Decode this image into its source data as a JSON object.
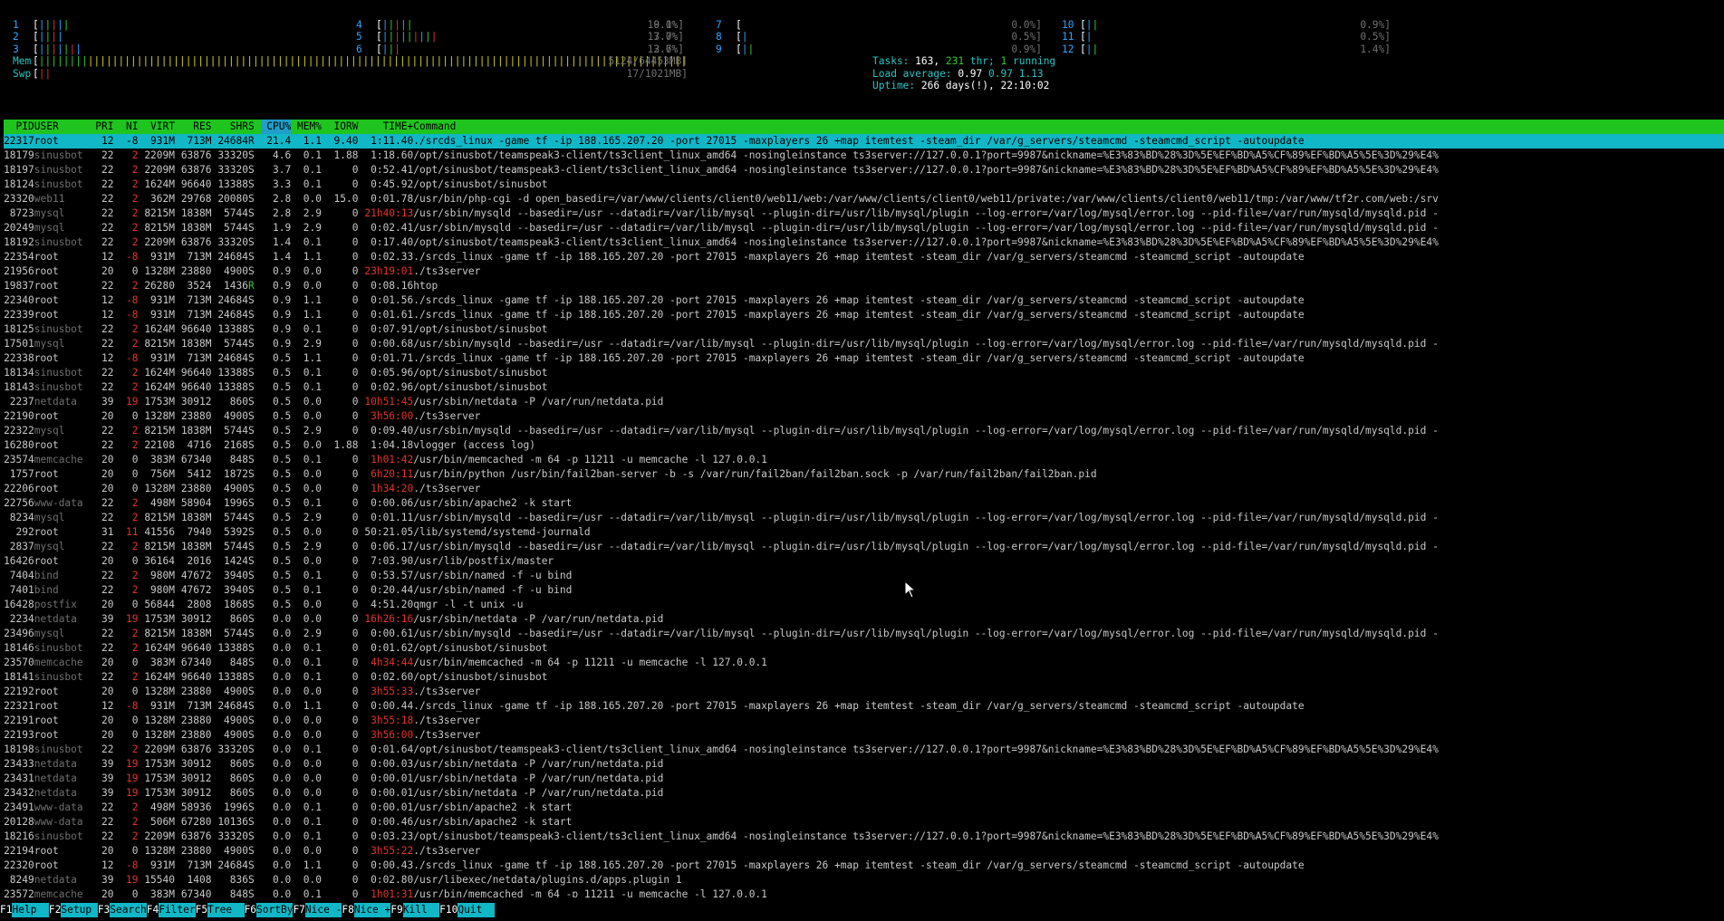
{
  "cpus": [
    {
      "id": "1",
      "bar": "|||||",
      "pct": "10.1%]"
    },
    {
      "id": "2",
      "bar": "||||",
      "pct": "7.0%]"
    },
    {
      "id": "3",
      "bar": "|||||||",
      "pct": "12.6%]"
    },
    {
      "id": "4",
      "bar": "|||||",
      "pct": "9.0%]"
    },
    {
      "id": "5",
      "bar": "|||||||||",
      "pct": "13.7%]"
    },
    {
      "id": "6",
      "bar": "|||",
      "pct": "3.7%]"
    },
    {
      "id": "7",
      "bar": "",
      "pct": "0.0%]"
    },
    {
      "id": "8",
      "bar": "|",
      "pct": "0.5%]"
    },
    {
      "id": "9",
      "bar": "||",
      "pct": "0.9%]"
    },
    {
      "id": "10",
      "bar": "||",
      "pct": "0.9%]"
    },
    {
      "id": "11",
      "bar": "|",
      "pct": "0.5%]"
    },
    {
      "id": "12",
      "bar": "||",
      "pct": "1.4%]"
    }
  ],
  "mem": {
    "label": "Mem",
    "bar": "||||||||||||||||||||||||||||||||||||||||||||||||||||||||||||||||||||||||||||||||||||||||||||||||||||||||||||||||||||||||||||||||||||||||||||||||||||",
    "value": "5124/64453MB]"
  },
  "swp": {
    "label": "Swp",
    "bar": "||",
    "value": "17/1021MB]"
  },
  "tasks": {
    "label": "Tasks:",
    "value": "163,",
    "thr": "231",
    "thr_label": "thr;",
    "running": "1",
    "running_label": "running"
  },
  "load": {
    "label": "Load average:",
    "v1": "0.97",
    "v2": "0.97",
    "v3": "1.13"
  },
  "uptime": {
    "label": "Uptime:",
    "value": "266 days(!), 22:10:02"
  },
  "columns": [
    "  PID",
    "USER     ",
    "PRI",
    " NI",
    " VIRT",
    "  RES",
    "  SHR",
    "S",
    "CPU%",
    "MEM%",
    "IORW ",
    "  TIME+ ",
    "Command"
  ],
  "processes": [
    [
      "22317",
      "root",
      "12",
      "-8",
      "931M",
      "713M",
      "24684",
      "R",
      "21.4",
      "1.1",
      "9.40",
      "1:11.40",
      "./srcds_linux -game tf -ip 188.165.207.20 -port 27015 -maxplayers 26 +map itemtest -steam_dir /var/g_servers/steamcmd -steamcmd_script -autoupdate"
    ],
    [
      "18179",
      "sinusbot",
      "22",
      "2",
      "2209M",
      "63876",
      "33320",
      "S",
      "4.6",
      "0.1",
      "1.88",
      "1:18.60",
      "/opt/sinusbot/teamspeak3-client/ts3client_linux_amd64 -nosingleinstance ts3server://127.0.0.1?port=9987&nickname=%E3%83%BD%28%3D%5E%EF%BD%A5%CF%89%EF%BD%A5%5E%3D%29%E4%"
    ],
    [
      "18197",
      "sinusbot",
      "22",
      "2",
      "2209M",
      "63876",
      "33320",
      "S",
      "3.7",
      "0.1",
      "0",
      "0:52.41",
      "/opt/sinusbot/teamspeak3-client/ts3client_linux_amd64 -nosingleinstance ts3server://127.0.0.1?port=9987&nickname=%E3%83%BD%28%3D%5E%EF%BD%A5%CF%89%EF%BD%A5%5E%3D%29%E4%"
    ],
    [
      "18124",
      "sinusbot",
      "22",
      "2",
      "1624M",
      "96640",
      "13388",
      "S",
      "3.3",
      "0.1",
      "0",
      "0:45.92",
      "/opt/sinusbot/sinusbot"
    ],
    [
      "23320",
      "web11",
      "22",
      "2",
      "362M",
      "29768",
      "20080",
      "S",
      "2.8",
      "0.0",
      "15.0",
      "0:01.78",
      "/usr/bin/php-cgi -d open_basedir=/var/www/clients/client0/web11/web:/var/www/clients/client0/web11/private:/var/www/clients/client0/web11/tmp:/var/www/tf2r.com/web:/srv"
    ],
    [
      "8723",
      "mysql",
      "22",
      "2",
      "8215M",
      "1838M",
      "5744",
      "S",
      "2.8",
      "2.9",
      "0",
      "21h40:13",
      "/usr/sbin/mysqld --basedir=/usr --datadir=/var/lib/mysql --plugin-dir=/usr/lib/mysql/plugin --log-error=/var/log/mysql/error.log --pid-file=/var/run/mysqld/mysqld.pid -"
    ],
    [
      "20249",
      "mysql",
      "22",
      "2",
      "8215M",
      "1838M",
      "5744",
      "S",
      "1.9",
      "2.9",
      "0",
      "0:02.41",
      "/usr/sbin/mysqld --basedir=/usr --datadir=/var/lib/mysql --plugin-dir=/usr/lib/mysql/plugin --log-error=/var/log/mysql/error.log --pid-file=/var/run/mysqld/mysqld.pid -"
    ],
    [
      "18192",
      "sinusbot",
      "22",
      "2",
      "2209M",
      "63876",
      "33320",
      "S",
      "1.4",
      "0.1",
      "0",
      "0:17.40",
      "/opt/sinusbot/teamspeak3-client/ts3client_linux_amd64 -nosingleinstance ts3server://127.0.0.1?port=9987&nickname=%E3%83%BD%28%3D%5E%EF%BD%A5%CF%89%EF%BD%A5%5E%3D%29%E4%"
    ],
    [
      "22354",
      "root",
      "12",
      "-8",
      "931M",
      "713M",
      "24684",
      "S",
      "1.4",
      "1.1",
      "0",
      "0:02.33",
      "./srcds_linux -game tf -ip 188.165.207.20 -port 27015 -maxplayers 26 +map itemtest -steam_dir /var/g_servers/steamcmd -steamcmd_script -autoupdate"
    ],
    [
      "21956",
      "root",
      "20",
      "0",
      "1328M",
      "23880",
      "4900",
      "S",
      "0.9",
      "0.0",
      "0",
      "23h19:01",
      "./ts3server"
    ],
    [
      "19837",
      "root",
      "22",
      "2",
      "26280",
      "3524",
      "1436",
      "R",
      "0.9",
      "0.0",
      "0",
      "0:08.16",
      "htop"
    ],
    [
      "22340",
      "root",
      "12",
      "-8",
      "931M",
      "713M",
      "24684",
      "S",
      "0.9",
      "1.1",
      "0",
      "0:01.56",
      "./srcds_linux -game tf -ip 188.165.207.20 -port 27015 -maxplayers 26 +map itemtest -steam_dir /var/g_servers/steamcmd -steamcmd_script -autoupdate"
    ],
    [
      "22339",
      "root",
      "12",
      "-8",
      "931M",
      "713M",
      "24684",
      "S",
      "0.9",
      "1.1",
      "0",
      "0:01.61",
      "./srcds_linux -game tf -ip 188.165.207.20 -port 27015 -maxplayers 26 +map itemtest -steam_dir /var/g_servers/steamcmd -steamcmd_script -autoupdate"
    ],
    [
      "18125",
      "sinusbot",
      "22",
      "2",
      "1624M",
      "96640",
      "13388",
      "S",
      "0.9",
      "0.1",
      "0",
      "0:07.91",
      "/opt/sinusbot/sinusbot"
    ],
    [
      "17501",
      "mysql",
      "22",
      "2",
      "8215M",
      "1838M",
      "5744",
      "S",
      "0.9",
      "2.9",
      "0",
      "0:00.68",
      "/usr/sbin/mysqld --basedir=/usr --datadir=/var/lib/mysql --plugin-dir=/usr/lib/mysql/plugin --log-error=/var/log/mysql/error.log --pid-file=/var/run/mysqld/mysqld.pid -"
    ],
    [
      "22338",
      "root",
      "12",
      "-8",
      "931M",
      "713M",
      "24684",
      "S",
      "0.5",
      "1.1",
      "0",
      "0:01.71",
      "./srcds_linux -game tf -ip 188.165.207.20 -port 27015 -maxplayers 26 +map itemtest -steam_dir /var/g_servers/steamcmd -steamcmd_script -autoupdate"
    ],
    [
      "18134",
      "sinusbot",
      "22",
      "2",
      "1624M",
      "96640",
      "13388",
      "S",
      "0.5",
      "0.1",
      "0",
      "0:05.96",
      "/opt/sinusbot/sinusbot"
    ],
    [
      "18143",
      "sinusbot",
      "22",
      "2",
      "1624M",
      "96640",
      "13388",
      "S",
      "0.5",
      "0.1",
      "0",
      "0:02.96",
      "/opt/sinusbot/sinusbot"
    ],
    [
      "2237",
      "netdata",
      "39",
      "19",
      "1753M",
      "30912",
      "860",
      "S",
      "0.5",
      "0.0",
      "0",
      "10h51:45",
      "/usr/sbin/netdata -P /var/run/netdata.pid"
    ],
    [
      "22190",
      "root",
      "20",
      "0",
      "1328M",
      "23880",
      "4900",
      "S",
      "0.5",
      "0.0",
      "0",
      "3h56:00",
      "./ts3server"
    ],
    [
      "22322",
      "mysql",
      "22",
      "2",
      "8215M",
      "1838M",
      "5744",
      "S",
      "0.5",
      "2.9",
      "0",
      "0:09.40",
      "/usr/sbin/mysqld --basedir=/usr --datadir=/var/lib/mysql --plugin-dir=/usr/lib/mysql/plugin --log-error=/var/log/mysql/error.log --pid-file=/var/run/mysqld/mysqld.pid -"
    ],
    [
      "16280",
      "root",
      "22",
      "2",
      "22108",
      "4716",
      "2168",
      "S",
      "0.5",
      "0.0",
      "1.88",
      "1:04.18",
      "vlogger (access log)"
    ],
    [
      "23574",
      "memcache",
      "20",
      "0",
      "383M",
      "67340",
      "848",
      "S",
      "0.5",
      "0.1",
      "0",
      "1h01:42",
      "/usr/bin/memcached -m 64 -p 11211 -u memcache -l 127.0.0.1"
    ],
    [
      "1757",
      "root",
      "20",
      "0",
      "756M",
      "5412",
      "1872",
      "S",
      "0.5",
      "0.0",
      "0",
      "6h20:11",
      "/usr/bin/python /usr/bin/fail2ban-server -b -s /var/run/fail2ban/fail2ban.sock -p /var/run/fail2ban/fail2ban.pid"
    ],
    [
      "22206",
      "root",
      "20",
      "0",
      "1328M",
      "23880",
      "4900",
      "S",
      "0.5",
      "0.0",
      "0",
      "1h34:20",
      "./ts3server"
    ],
    [
      "22756",
      "www-data",
      "22",
      "2",
      "498M",
      "58904",
      "1996",
      "S",
      "0.5",
      "0.1",
      "0",
      "0:00.06",
      "/usr/sbin/apache2 -k start"
    ],
    [
      "8234",
      "mysql",
      "22",
      "2",
      "8215M",
      "1838M",
      "5744",
      "S",
      "0.5",
      "2.9",
      "0",
      "0:01.11",
      "/usr/sbin/mysqld --basedir=/usr --datadir=/var/lib/mysql --plugin-dir=/usr/lib/mysql/plugin --log-error=/var/log/mysql/error.log --pid-file=/var/run/mysqld/mysqld.pid -"
    ],
    [
      "292",
      "root",
      "31",
      "11",
      "41556",
      "7940",
      "5392",
      "S",
      "0.5",
      "0.0",
      "0",
      "50:21.05",
      "/lib/systemd/systemd-journald"
    ],
    [
      "2837",
      "mysql",
      "22",
      "2",
      "8215M",
      "1838M",
      "5744",
      "S",
      "0.5",
      "2.9",
      "0",
      "0:06.17",
      "/usr/sbin/mysqld --basedir=/usr --datadir=/var/lib/mysql --plugin-dir=/usr/lib/mysql/plugin --log-error=/var/log/mysql/error.log --pid-file=/var/run/mysqld/mysqld.pid -"
    ],
    [
      "16426",
      "root",
      "20",
      "0",
      "36164",
      "2016",
      "1424",
      "S",
      "0.5",
      "0.0",
      "0",
      "7:03.90",
      "/usr/lib/postfix/master"
    ],
    [
      "7404",
      "bind",
      "22",
      "2",
      "980M",
      "47672",
      "3940",
      "S",
      "0.5",
      "0.1",
      "0",
      "0:53.57",
      "/usr/sbin/named -f -u bind"
    ],
    [
      "7401",
      "bind",
      "22",
      "2",
      "980M",
      "47672",
      "3940",
      "S",
      "0.5",
      "0.1",
      "0",
      "0:20.44",
      "/usr/sbin/named -f -u bind"
    ],
    [
      "16428",
      "postfix",
      "20",
      "0",
      "56844",
      "2808",
      "1868",
      "S",
      "0.5",
      "0.0",
      "0",
      "4:51.20",
      "qmgr -l -t unix -u"
    ],
    [
      "2234",
      "netdata",
      "39",
      "19",
      "1753M",
      "30912",
      "860",
      "S",
      "0.0",
      "0.0",
      "0",
      "16h26:16",
      "/usr/sbin/netdata -P /var/run/netdata.pid"
    ],
    [
      "23496",
      "mysql",
      "22",
      "2",
      "8215M",
      "1838M",
      "5744",
      "S",
      "0.0",
      "2.9",
      "0",
      "0:00.61",
      "/usr/sbin/mysqld --basedir=/usr --datadir=/var/lib/mysql --plugin-dir=/usr/lib/mysql/plugin --log-error=/var/log/mysql/error.log --pid-file=/var/run/mysqld/mysqld.pid -"
    ],
    [
      "18146",
      "sinusbot",
      "22",
      "2",
      "1624M",
      "96640",
      "13388",
      "S",
      "0.0",
      "0.1",
      "0",
      "0:01.62",
      "/opt/sinusbot/sinusbot"
    ],
    [
      "23570",
      "memcache",
      "20",
      "0",
      "383M",
      "67340",
      "848",
      "S",
      "0.0",
      "0.1",
      "0",
      "4h34:44",
      "/usr/bin/memcached -m 64 -p 11211 -u memcache -l 127.0.0.1"
    ],
    [
      "18141",
      "sinusbot",
      "22",
      "2",
      "1624M",
      "96640",
      "13388",
      "S",
      "0.0",
      "0.1",
      "0",
      "0:02.60",
      "/opt/sinusbot/sinusbot"
    ],
    [
      "22192",
      "root",
      "20",
      "0",
      "1328M",
      "23880",
      "4900",
      "S",
      "0.0",
      "0.0",
      "0",
      "3h55:33",
      "./ts3server"
    ],
    [
      "22321",
      "root",
      "12",
      "-8",
      "931M",
      "713M",
      "24684",
      "S",
      "0.0",
      "1.1",
      "0",
      "0:00.44",
      "./srcds_linux -game tf -ip 188.165.207.20 -port 27015 -maxplayers 26 +map itemtest -steam_dir /var/g_servers/steamcmd -steamcmd_script -autoupdate"
    ],
    [
      "22191",
      "root",
      "20",
      "0",
      "1328M",
      "23880",
      "4900",
      "S",
      "0.0",
      "0.0",
      "0",
      "3h55:18",
      "./ts3server"
    ],
    [
      "22193",
      "root",
      "20",
      "0",
      "1328M",
      "23880",
      "4900",
      "S",
      "0.0",
      "0.0",
      "0",
      "3h56:00",
      "./ts3server"
    ],
    [
      "18198",
      "sinusbot",
      "22",
      "2",
      "2209M",
      "63876",
      "33320",
      "S",
      "0.0",
      "0.1",
      "0",
      "0:01.64",
      "/opt/sinusbot/teamspeak3-client/ts3client_linux_amd64 -nosingleinstance ts3server://127.0.0.1?port=9987&nickname=%E3%83%BD%28%3D%5E%EF%BD%A5%CF%89%EF%BD%A5%5E%3D%29%E4%"
    ],
    [
      "23433",
      "netdata",
      "39",
      "19",
      "1753M",
      "30912",
      "860",
      "S",
      "0.0",
      "0.0",
      "0",
      "0:00.03",
      "/usr/sbin/netdata -P /var/run/netdata.pid"
    ],
    [
      "23431",
      "netdata",
      "39",
      "19",
      "1753M",
      "30912",
      "860",
      "S",
      "0.0",
      "0.0",
      "0",
      "0:00.01",
      "/usr/sbin/netdata -P /var/run/netdata.pid"
    ],
    [
      "23432",
      "netdata",
      "39",
      "19",
      "1753M",
      "30912",
      "860",
      "S",
      "0.0",
      "0.0",
      "0",
      "0:00.01",
      "/usr/sbin/netdata -P /var/run/netdata.pid"
    ],
    [
      "23491",
      "www-data",
      "22",
      "2",
      "498M",
      "58936",
      "1996",
      "S",
      "0.0",
      "0.1",
      "0",
      "0:00.01",
      "/usr/sbin/apache2 -k start"
    ],
    [
      "20128",
      "www-data",
      "22",
      "2",
      "506M",
      "67280",
      "10136",
      "S",
      "0.0",
      "0.1",
      "0",
      "0:00.46",
      "/usr/sbin/apache2 -k start"
    ],
    [
      "18216",
      "sinusbot",
      "22",
      "2",
      "2209M",
      "63876",
      "33320",
      "S",
      "0.0",
      "0.1",
      "0",
      "0:03.23",
      "/opt/sinusbot/teamspeak3-client/ts3client_linux_amd64 -nosingleinstance ts3server://127.0.0.1?port=9987&nickname=%E3%83%BD%28%3D%5E%EF%BD%A5%CF%89%EF%BD%A5%5E%3D%29%E4%"
    ],
    [
      "22194",
      "root",
      "20",
      "0",
      "1328M",
      "23880",
      "4900",
      "S",
      "0.0",
      "0.0",
      "0",
      "3h55:22",
      "./ts3server"
    ],
    [
      "22320",
      "root",
      "12",
      "-8",
      "931M",
      "713M",
      "24684",
      "S",
      "0.0",
      "1.1",
      "0",
      "0:00.43",
      "./srcds_linux -game tf -ip 188.165.207.20 -port 27015 -maxplayers 26 +map itemtest -steam_dir /var/g_servers/steamcmd -steamcmd_script -autoupdate"
    ],
    [
      "8249",
      "netdata",
      "39",
      "19",
      "15540",
      "1408",
      "836",
      "S",
      "0.0",
      "0.0",
      "0",
      "0:02.80",
      "/usr/libexec/netdata/plugins.d/apps.plugin 1"
    ],
    [
      "23572",
      "memcache",
      "20",
      "0",
      "383M",
      "67340",
      "848",
      "S",
      "0.0",
      "0.1",
      "0",
      "1h01:31",
      "/usr/bin/memcached -m 64 -p 11211 -u memcache -l 127.0.0.1"
    ]
  ],
  "fkeys": [
    {
      "key": "F1",
      "label": "Help  "
    },
    {
      "key": "F2",
      "label": "Setup "
    },
    {
      "key": "F3",
      "label": "Search"
    },
    {
      "key": "F4",
      "label": "Filter"
    },
    {
      "key": "F5",
      "label": "Tree  "
    },
    {
      "key": "F6",
      "label": "SortBy"
    },
    {
      "key": "F7",
      "label": "Nice -"
    },
    {
      "key": "F8",
      "label": "Nice +"
    },
    {
      "key": "F9",
      "label": "Kill  "
    },
    {
      "key": "F10",
      "label": "Quit  "
    }
  ],
  "colors": {
    "header_bg": "#1fc41f",
    "sort_bg": "#1e9ec8",
    "selection_bg": "#11b7c6",
    "background": "#000000"
  }
}
